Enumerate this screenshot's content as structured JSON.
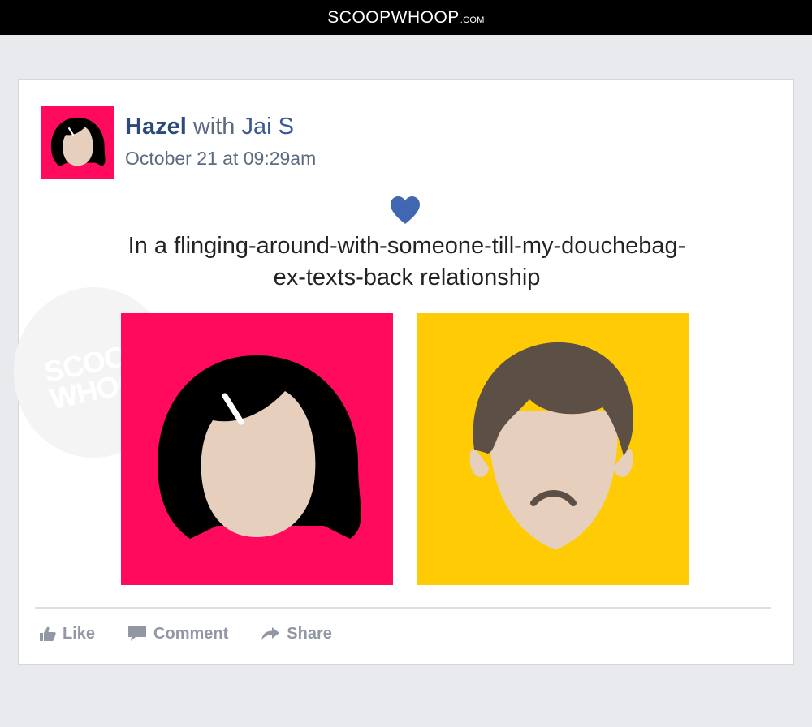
{
  "header": {
    "brand": "SCOOPWHOOP",
    "brand_suffix": ".COM"
  },
  "watermark": {
    "text": "SCOOP WHOOP"
  },
  "post": {
    "author": "Hazel",
    "with_word": "with",
    "tagged": "Jai S",
    "timestamp": "October 21 at 09:29am",
    "status_icon": "heart-icon",
    "status": "In a flinging-around-with-someone-till-my-douchebag-ex-texts-back relationship"
  },
  "actions": {
    "like": "Like",
    "comment": "Comment",
    "share": "Share"
  },
  "colors": {
    "brand_blue": "#3b5998",
    "her_bg": "#ff0a5c",
    "him_bg": "#ffcb05",
    "heart": "#4267b2",
    "hair_her": "#000000",
    "hair_him": "#5c4f45",
    "skin": "#e6cfbd"
  }
}
